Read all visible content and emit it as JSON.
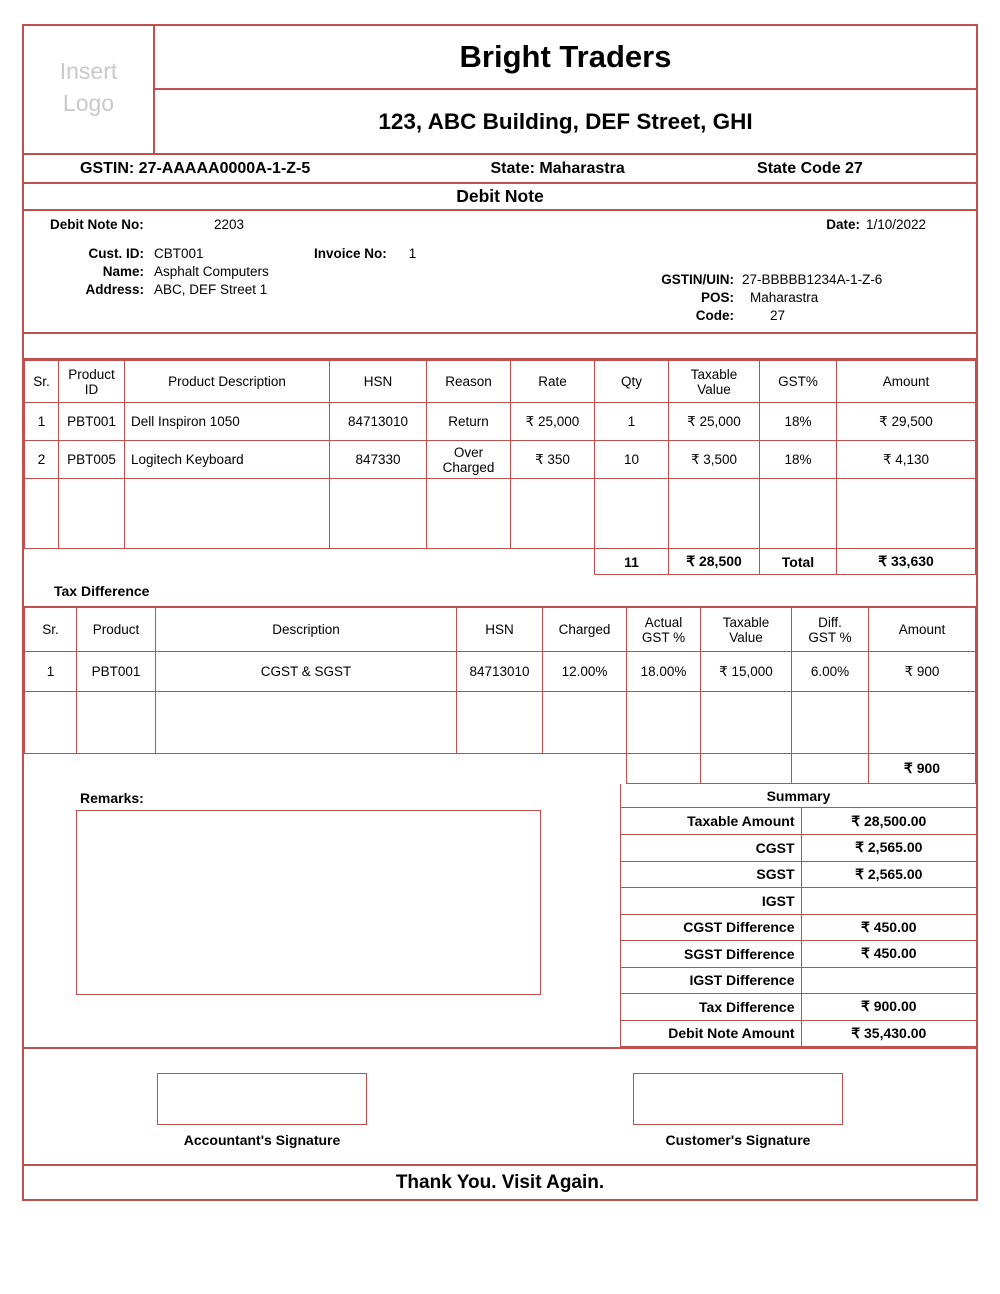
{
  "document": {
    "logo_placeholder_line1": "Insert",
    "logo_placeholder_line2": "Logo",
    "company_name": "Bright Traders",
    "company_address": "123, ABC Building, DEF Street, GHI",
    "gstin_label_value": "GSTIN: 27-AAAAA0000A-1-Z-5",
    "state_label_value": "State: Maharastra",
    "state_code_label_value": "State Code 27",
    "doc_title": "Debit Note",
    "border_color": "#C0504D",
    "logo_text_color": "#C9C9C9"
  },
  "meta": {
    "debit_note_no_label": "Debit Note No:",
    "debit_note_no_value": "2203",
    "date_label": "Date:",
    "date_value": "1/10/2022",
    "cust_id_label": "Cust. ID:",
    "cust_id_value": "CBT001",
    "invoice_no_label": "Invoice No:",
    "invoice_no_value": "1",
    "name_label": "Name:",
    "name_value": "Asphalt Computers",
    "address_label": "Address:",
    "address_value": "ABC, DEF Street 1",
    "gstin_uin_label": "GSTIN/UIN:",
    "gstin_uin_value": "27-BBBBB1234A-1-Z-6",
    "pos_label": "POS:",
    "pos_value": "Maharastra",
    "code_label": "Code:",
    "code_value": "27"
  },
  "items_table": {
    "headers": {
      "sr": "Sr.",
      "product_id_l1": "Product",
      "product_id_l2": "ID",
      "description": "Product Description",
      "hsn": "HSN",
      "reason": "Reason",
      "rate": "Rate",
      "qty": "Qty",
      "taxable_l1": "Taxable",
      "taxable_l2": "Value",
      "gst_pct": "GST%",
      "amount": "Amount"
    },
    "rows": [
      {
        "sr": "1",
        "product_id": "PBT001",
        "description": "Dell Inspiron 1050",
        "hsn": "84713010",
        "reason": "Return",
        "rate": "₹ 25,000",
        "qty": "1",
        "taxable_value": "₹ 25,000",
        "gst_pct": "18%",
        "amount": "₹ 29,500"
      },
      {
        "sr": "2",
        "product_id": "PBT005",
        "description": "Logitech Keyboard",
        "hsn": "847330",
        "reason": "Over Charged",
        "rate": "₹ 350",
        "qty": "10",
        "taxable_value": "₹ 3,500",
        "gst_pct": "18%",
        "amount": "₹ 4,130"
      }
    ],
    "totals": {
      "qty": "11",
      "taxable_value": "₹ 28,500",
      "total_label": "Total",
      "amount": "₹ 33,630"
    }
  },
  "tax_difference": {
    "section_title": "Tax Difference",
    "headers": {
      "sr": "Sr.",
      "product": "Product",
      "description": "Description",
      "hsn": "HSN",
      "charged": "Charged",
      "actual_l1": "Actual",
      "actual_l2": "GST %",
      "taxable_l1": "Taxable",
      "taxable_l2": "Value",
      "diff_l1": "Diff.",
      "diff_l2": "GST %",
      "amount": "Amount"
    },
    "rows": [
      {
        "sr": "1",
        "product": "PBT001",
        "description": "CGST & SGST",
        "hsn": "84713010",
        "charged": "12.00%",
        "actual_gst": "18.00%",
        "taxable_value": "₹ 15,000",
        "diff_gst": "6.00%",
        "amount": "₹ 900"
      }
    ],
    "total_amount": "₹ 900"
  },
  "remarks": {
    "label": "Remarks:",
    "value": ""
  },
  "summary": {
    "title": "Summary",
    "rows": [
      {
        "label": "Taxable Amount",
        "value": "₹ 28,500.00"
      },
      {
        "label": "CGST",
        "value": "₹ 2,565.00"
      },
      {
        "label": "SGST",
        "value": "₹ 2,565.00"
      },
      {
        "label": "IGST",
        "value": ""
      },
      {
        "label": "CGST Difference",
        "value": "₹ 450.00"
      },
      {
        "label": "SGST Difference",
        "value": "₹ 450.00"
      },
      {
        "label": "IGST Difference",
        "value": ""
      },
      {
        "label": "Tax Difference",
        "value": "₹ 900.00"
      },
      {
        "label": "Debit Note Amount",
        "value": "₹ 35,430.00"
      }
    ]
  },
  "footer": {
    "accountant_signature": "Accountant's Signature",
    "customer_signature": "Customer's Signature",
    "thank_you": "Thank You. Visit Again."
  }
}
